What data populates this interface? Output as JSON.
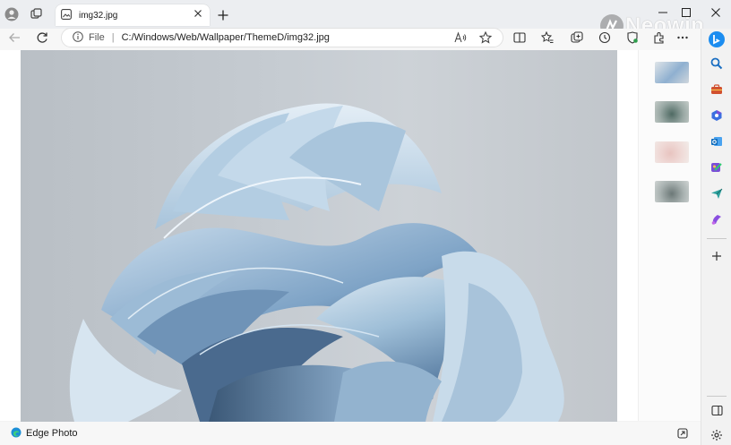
{
  "tab": {
    "title": "img32.jpg"
  },
  "address": {
    "scheme_label": "File",
    "url": "C:/Windows/Web/Wallpaper/ThemeD/img32.jpg"
  },
  "status": {
    "label": "Edge Photo"
  },
  "watermark": "Neowin",
  "thumbnails": [
    {
      "name": "thumb-blue-bloom"
    },
    {
      "name": "thumb-grey-swirl"
    },
    {
      "name": "thumb-pink-bloom"
    },
    {
      "name": "thumb-grey-waves"
    }
  ],
  "colors": {
    "accent": "#0f6cbd",
    "tab_bg": "#ffffff",
    "titlebar_bg": "#eceef1"
  }
}
